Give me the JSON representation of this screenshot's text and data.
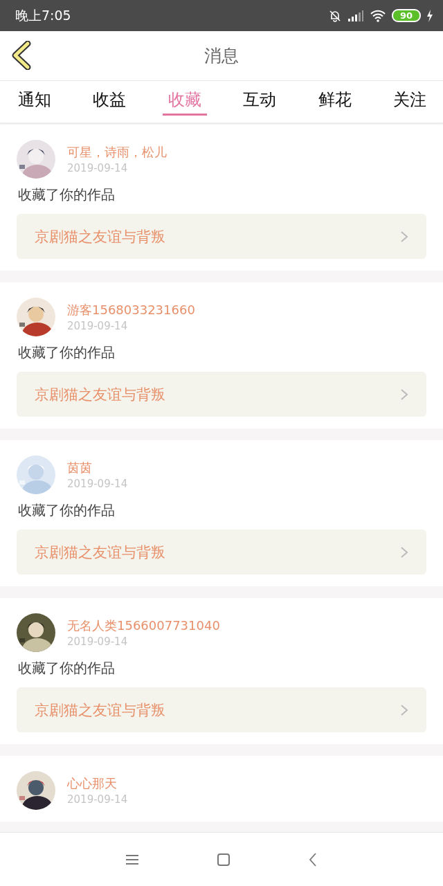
{
  "status_bar": {
    "time": "晚上7:05",
    "battery": "90"
  },
  "header": {
    "title": "消息"
  },
  "tabs": [
    {
      "label": "通知",
      "selected": false
    },
    {
      "label": "收益",
      "selected": false
    },
    {
      "label": "收藏",
      "selected": true
    },
    {
      "label": "互动",
      "selected": false
    },
    {
      "label": "鲜花",
      "selected": false
    },
    {
      "label": "关注",
      "selected": false
    }
  ],
  "messages": [
    {
      "user": "可星，诗雨，松儿",
      "date": "2019-09-14",
      "action": "收藏了你的作品",
      "work": "京剧猫之友谊与背叛"
    },
    {
      "user": "游客1568033231660",
      "date": "2019-09-14",
      "action": "收藏了你的作品",
      "work": "京剧猫之友谊与背叛"
    },
    {
      "user": "茵茵",
      "date": "2019-09-14",
      "action": "收藏了你的作品",
      "work": "京剧猫之友谊与背叛"
    },
    {
      "user": "无名人类1566007731040",
      "date": "2019-09-14",
      "action": "收藏了你的作品",
      "work": "京剧猫之友谊与背叛"
    },
    {
      "user": "心心那天",
      "date": "2019-09-14"
    }
  ]
}
